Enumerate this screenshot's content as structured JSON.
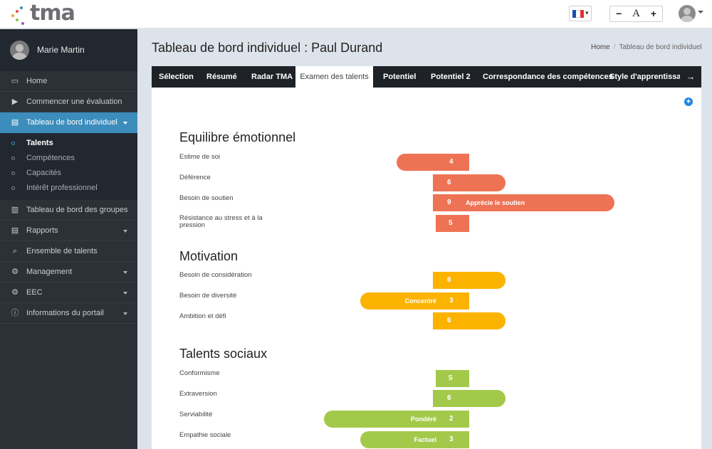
{
  "app": {
    "logo_text": "tma"
  },
  "header": {
    "font_controls": {
      "decrease": "−",
      "normal": "A",
      "increase": "+"
    },
    "flag_colors": [
      "#1f4bb1",
      "#ffffff",
      "#e4322b"
    ]
  },
  "sidebar": {
    "user_name": "Marie Martin",
    "items": [
      {
        "label": "Home",
        "icon": "monitor-icon"
      },
      {
        "label": "Commencer une évaluation",
        "icon": "play-icon"
      },
      {
        "label": "Tableau de bord individuel",
        "icon": "file-icon",
        "active": true
      },
      {
        "label": "Tableau de bord des groupes",
        "icon": "book-icon"
      },
      {
        "label": "Rapports",
        "icon": "document-icon"
      },
      {
        "label": "Ensemble de talents",
        "icon": "search-icon"
      },
      {
        "label": "Management",
        "icon": "cogs-icon"
      },
      {
        "label": "EEC",
        "icon": "cogs-icon"
      },
      {
        "label": "Informations du portail",
        "icon": "info-icon"
      }
    ],
    "submenu": [
      {
        "label": "Talents",
        "active": true
      },
      {
        "label": "Compétences"
      },
      {
        "label": "Capacités"
      },
      {
        "label": "Intérêt professionnel"
      }
    ]
  },
  "page": {
    "title": "Tableau de bord individuel : Paul Durand",
    "breadcrumb": [
      "Home",
      "Tableau de bord individuel"
    ]
  },
  "tabs": [
    {
      "label": "Sélection"
    },
    {
      "label": "Résumé"
    },
    {
      "label": "Radar TMA"
    },
    {
      "label": "Examen des talents",
      "active": true
    },
    {
      "label": "Potentiel"
    },
    {
      "label": "Potentiel 2"
    },
    {
      "label": "Correspondance des compétences"
    },
    {
      "label": "Style d'apprentissage"
    }
  ],
  "chart_data": {
    "type": "bar",
    "scale": [
      1,
      10
    ],
    "center": 5,
    "colors": {
      "emotional": "#ee7355",
      "motivation": "#fbb300",
      "social": "#a3c94a"
    },
    "sections": [
      {
        "title": "Equilibre émotionnel",
        "color_key": "emotional",
        "rows": [
          {
            "label": "Estime de soi",
            "value": 4,
            "note": ""
          },
          {
            "label": "Déférence",
            "value": 6,
            "note": ""
          },
          {
            "label": "Besoin de soutien",
            "value": 9,
            "note": "Apprécie le soutien"
          },
          {
            "label": "Résistance au stress et à la pression",
            "value": 5,
            "note": ""
          }
        ]
      },
      {
        "title": "Motivation",
        "color_key": "motivation",
        "rows": [
          {
            "label": "Besoin de considération",
            "value": 6,
            "note": ""
          },
          {
            "label": "Besoin de diversité",
            "value": 3,
            "note": "Concentré"
          },
          {
            "label": "Ambition et défi",
            "value": 6,
            "note": ""
          }
        ]
      },
      {
        "title": "Talents sociaux",
        "color_key": "social",
        "rows": [
          {
            "label": "Conformisme",
            "value": 5,
            "note": ""
          },
          {
            "label": "Extraversion",
            "value": 6,
            "note": ""
          },
          {
            "label": "Serviabilité",
            "value": 2,
            "note": "Pondéré"
          },
          {
            "label": "Empathie sociale",
            "value": 3,
            "note": "Factuel"
          }
        ]
      }
    ]
  }
}
